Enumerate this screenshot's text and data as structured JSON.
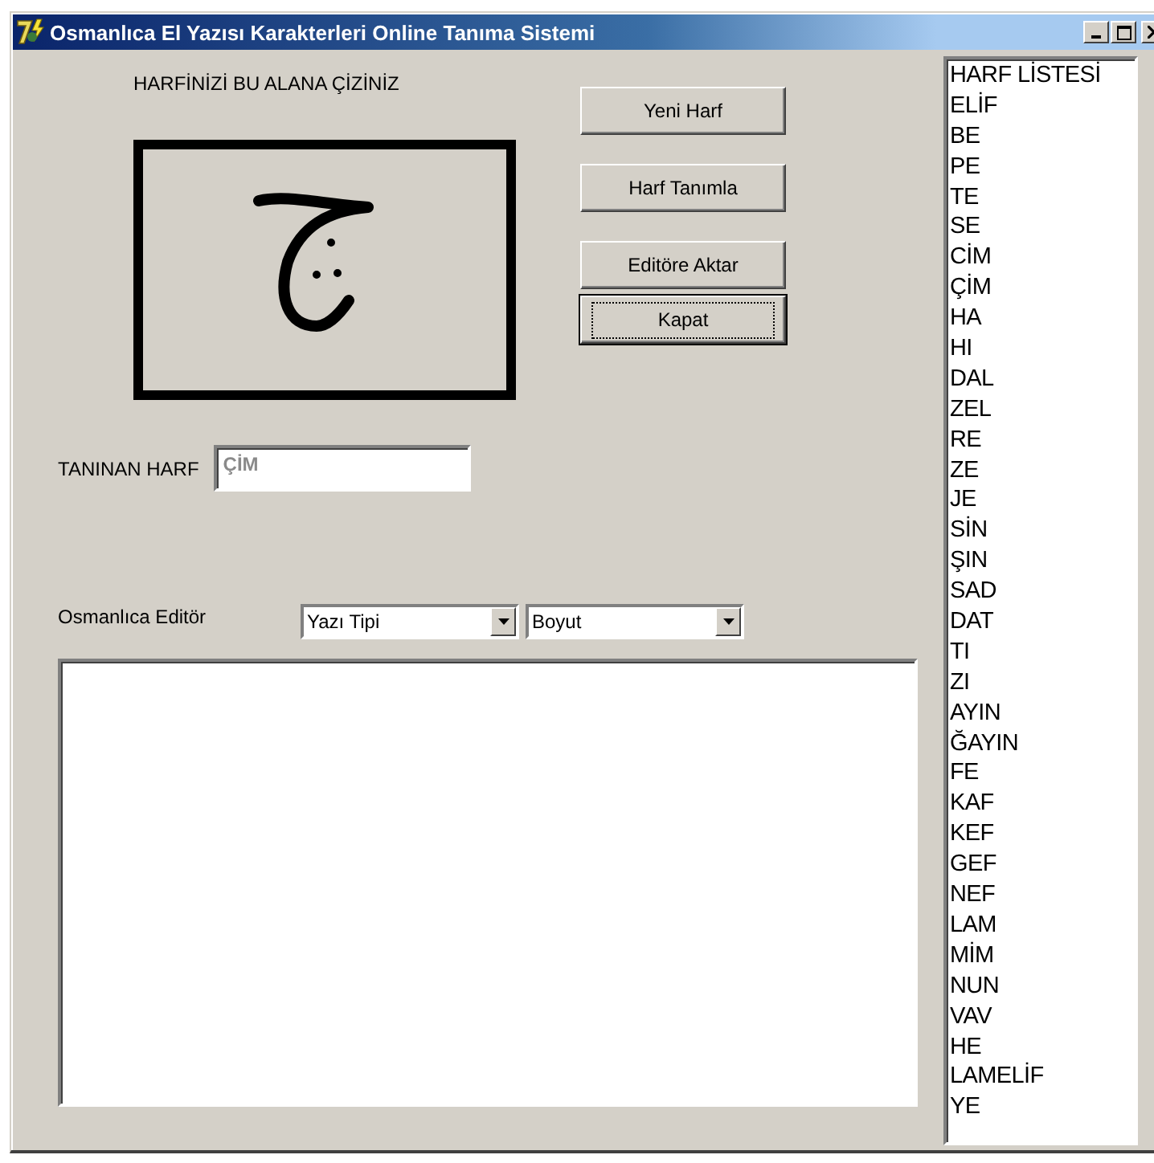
{
  "window": {
    "title": "Osmanlıca El Yazısı Karakterleri Online Tanıma Sistemi"
  },
  "draw_area": {
    "label": "HARFİNİZİ BU ALANA ÇİZİNİZ"
  },
  "buttons": [
    {
      "label": "Yeni Harf",
      "focused": false
    },
    {
      "label": "Harf Tanımla",
      "focused": false
    },
    {
      "label": "Editöre Aktar",
      "focused": false
    },
    {
      "label": "Kapat",
      "focused": true
    }
  ],
  "recognized": {
    "label": "TANINAN HARF",
    "value": "ÇİM",
    "disabled": true
  },
  "editor": {
    "label": "Osmanlıca Editör",
    "font_select": "Yazı Tipi",
    "size_select": "Boyut"
  },
  "letter_list": [
    "HARF LİSTESİ",
    "ELİF",
    "BE",
    "PE",
    "TE",
    "SE",
    "CİM",
    "ÇİM",
    "HA",
    "HI",
    "DAL",
    "ZEL",
    "RE",
    "ZE",
    "JE",
    "SİN",
    "ŞIN",
    "SAD",
    "DAT",
    "TI",
    "ZI",
    "AYIN",
    "ĞAYIN",
    "FE",
    "KAF",
    "KEF",
    "GEF",
    "NEF",
    "LAM",
    "MİM",
    "NUN",
    "VAV",
    "HE",
    "LAMELİF",
    "YE"
  ]
}
